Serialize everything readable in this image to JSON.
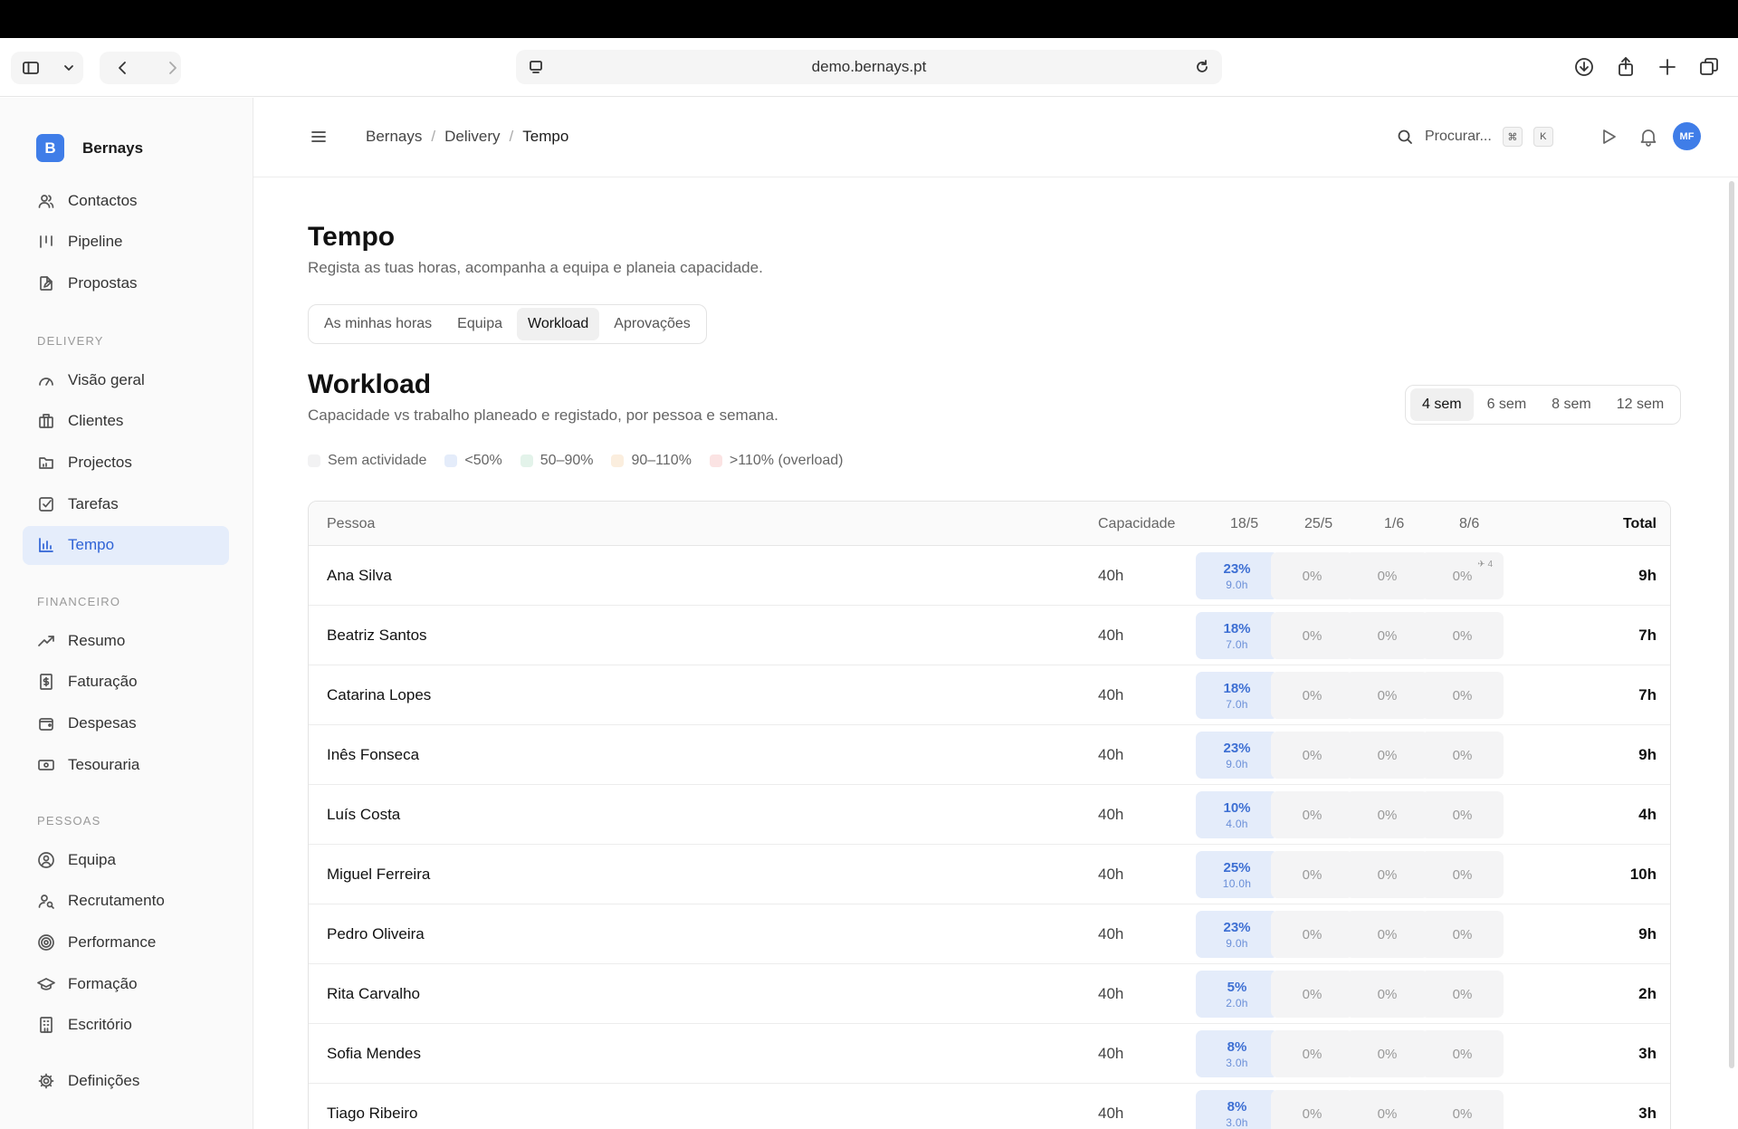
{
  "browser": {
    "url": "demo.bernays.pt"
  },
  "brand": {
    "logo_letter": "B",
    "name": "Bernays"
  },
  "nav_top": [
    {
      "label": "Contactos",
      "icon": "users-icon"
    },
    {
      "label": "Pipeline",
      "icon": "pipeline-icon"
    },
    {
      "label": "Propostas",
      "icon": "document-edit-icon"
    }
  ],
  "sections": {
    "delivery": "DELIVERY",
    "financeiro": "FINANCEIRO",
    "pessoas": "PESSOAS"
  },
  "nav_delivery": [
    {
      "label": "Visão geral",
      "icon": "gauge-icon"
    },
    {
      "label": "Clientes",
      "icon": "building-icon"
    },
    {
      "label": "Projectos",
      "icon": "folder-icon"
    },
    {
      "label": "Tarefas",
      "icon": "checkbox-icon"
    },
    {
      "label": "Tempo",
      "icon": "bar-chart-icon",
      "active": true
    }
  ],
  "nav_financeiro": [
    {
      "label": "Resumo",
      "icon": "trend-up-icon"
    },
    {
      "label": "Faturação",
      "icon": "invoice-icon"
    },
    {
      "label": "Despesas",
      "icon": "wallet-icon"
    },
    {
      "label": "Tesouraria",
      "icon": "banknote-icon"
    }
  ],
  "nav_pessoas": [
    {
      "label": "Equipa",
      "icon": "user-circle-icon"
    },
    {
      "label": "Recrutamento",
      "icon": "user-search-icon"
    },
    {
      "label": "Performance",
      "icon": "target-icon"
    },
    {
      "label": "Formação",
      "icon": "graduation-cap-icon"
    },
    {
      "label": "Escritório",
      "icon": "office-building-icon"
    }
  ],
  "nav_settings": {
    "label": "Definições",
    "icon": "gear-icon"
  },
  "header": {
    "breadcrumb": [
      "Bernays",
      "Delivery",
      "Tempo"
    ],
    "search_label": "Procurar...",
    "kbd1": "⌘",
    "kbd2": "K",
    "avatar": "MF"
  },
  "page": {
    "title": "Tempo",
    "subtitle": "Regista as tuas horas, acompanha a equipa e planeia capacidade.",
    "tabs": [
      "As minhas horas",
      "Equipa",
      "Workload",
      "Aprovações"
    ],
    "active_tab": "Workload"
  },
  "workload": {
    "title": "Workload",
    "subtitle": "Capacidade vs trabalho planeado e registado, por pessoa e semana.",
    "ranges": [
      "4 sem",
      "6 sem",
      "8 sem",
      "12 sem"
    ],
    "active_range": "4 sem",
    "legend": [
      {
        "label": "Sem actividade",
        "color": "#f2f2f3"
      },
      {
        "label": "<50%",
        "color": "#e4ecfa"
      },
      {
        "label": "50–90%",
        "color": "#e3f3ea"
      },
      {
        "label": "90–110%",
        "color": "#fbeede"
      },
      {
        "label": ">110% (overload)",
        "color": "#fbe3e3"
      }
    ],
    "columns": {
      "person": "Pessoa",
      "capacity": "Capacidade",
      "weeks": [
        "18/5",
        "25/5",
        "1/6",
        "8/6"
      ],
      "total": "Total"
    },
    "rows": [
      {
        "name": "Ana Silva",
        "capacity": "40h",
        "weeks": [
          {
            "pct": "23%",
            "hrs": "9.0h"
          },
          {
            "pct": "0%"
          },
          {
            "pct": "0%"
          },
          {
            "pct": "0%",
            "flag": "✈ 4"
          }
        ],
        "total": "9h"
      },
      {
        "name": "Beatriz Santos",
        "capacity": "40h",
        "weeks": [
          {
            "pct": "18%",
            "hrs": "7.0h"
          },
          {
            "pct": "0%"
          },
          {
            "pct": "0%"
          },
          {
            "pct": "0%"
          }
        ],
        "total": "7h"
      },
      {
        "name": "Catarina Lopes",
        "capacity": "40h",
        "weeks": [
          {
            "pct": "18%",
            "hrs": "7.0h"
          },
          {
            "pct": "0%"
          },
          {
            "pct": "0%"
          },
          {
            "pct": "0%"
          }
        ],
        "total": "7h"
      },
      {
        "name": "Inês Fonseca",
        "capacity": "40h",
        "weeks": [
          {
            "pct": "23%",
            "hrs": "9.0h"
          },
          {
            "pct": "0%"
          },
          {
            "pct": "0%"
          },
          {
            "pct": "0%"
          }
        ],
        "total": "9h"
      },
      {
        "name": "Luís Costa",
        "capacity": "40h",
        "weeks": [
          {
            "pct": "10%",
            "hrs": "4.0h"
          },
          {
            "pct": "0%"
          },
          {
            "pct": "0%"
          },
          {
            "pct": "0%"
          }
        ],
        "total": "4h"
      },
      {
        "name": "Miguel Ferreira",
        "capacity": "40h",
        "weeks": [
          {
            "pct": "25%",
            "hrs": "10.0h"
          },
          {
            "pct": "0%"
          },
          {
            "pct": "0%"
          },
          {
            "pct": "0%"
          }
        ],
        "total": "10h"
      },
      {
        "name": "Pedro Oliveira",
        "capacity": "40h",
        "weeks": [
          {
            "pct": "23%",
            "hrs": "9.0h"
          },
          {
            "pct": "0%"
          },
          {
            "pct": "0%"
          },
          {
            "pct": "0%"
          }
        ],
        "total": "9h"
      },
      {
        "name": "Rita Carvalho",
        "capacity": "40h",
        "weeks": [
          {
            "pct": "5%",
            "hrs": "2.0h"
          },
          {
            "pct": "0%"
          },
          {
            "pct": "0%"
          },
          {
            "pct": "0%"
          }
        ],
        "total": "2h"
      },
      {
        "name": "Sofia Mendes",
        "capacity": "40h",
        "weeks": [
          {
            "pct": "8%",
            "hrs": "3.0h"
          },
          {
            "pct": "0%"
          },
          {
            "pct": "0%"
          },
          {
            "pct": "0%"
          }
        ],
        "total": "3h"
      },
      {
        "name": "Tiago Ribeiro",
        "capacity": "40h",
        "weeks": [
          {
            "pct": "8%",
            "hrs": "3.0h"
          },
          {
            "pct": "0%"
          },
          {
            "pct": "0%"
          },
          {
            "pct": "0%"
          }
        ],
        "total": "3h"
      }
    ]
  }
}
